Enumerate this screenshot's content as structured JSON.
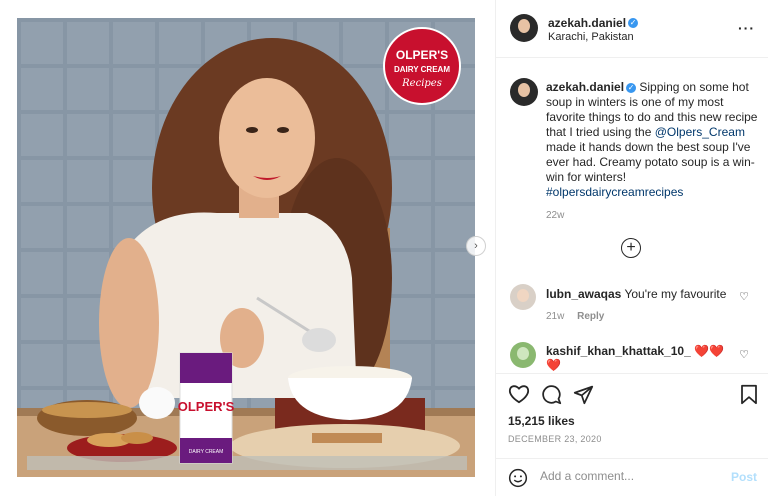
{
  "post": {
    "image_badge": {
      "line1": "OLPER'S",
      "line2": "DAIRY CREAM",
      "line3": "Recipes"
    },
    "product_label": {
      "brand": "OLPER'S",
      "sub": "DAIRY CREAM"
    }
  },
  "header": {
    "username": "azekah.daniel",
    "location": "Karachi, Pakistan",
    "more_icon": "ellipsis-icon"
  },
  "caption": {
    "username": "azekah.daniel",
    "text_before": " Sipping on some hot soup in winters is one of my most favorite things to do and this new recipe that I tried using the ",
    "mention": "@Olpers_Cream",
    "text_after": " made it hands down the best soup I've ever had. Creamy potato soup is a win-win for winters! ",
    "hashtag": "#olpersdairycreamrecipes",
    "time": "22w"
  },
  "comments": [
    {
      "username": "lubn_awaqas",
      "text": "You're my favourite",
      "time": "21w",
      "reply": "Reply"
    },
    {
      "username": "kashif_khan_khattak_10_",
      "text": "❤️❤️❤️"
    }
  ],
  "stats": {
    "likes": "15,215 likes",
    "date": "DECEMBER 23, 2020"
  },
  "add_comment": {
    "placeholder": "Add a comment...",
    "post_label": "Post"
  },
  "colors": {
    "link": "#00376b",
    "verified": "#3897f0",
    "badge_red": "#c8102e"
  }
}
